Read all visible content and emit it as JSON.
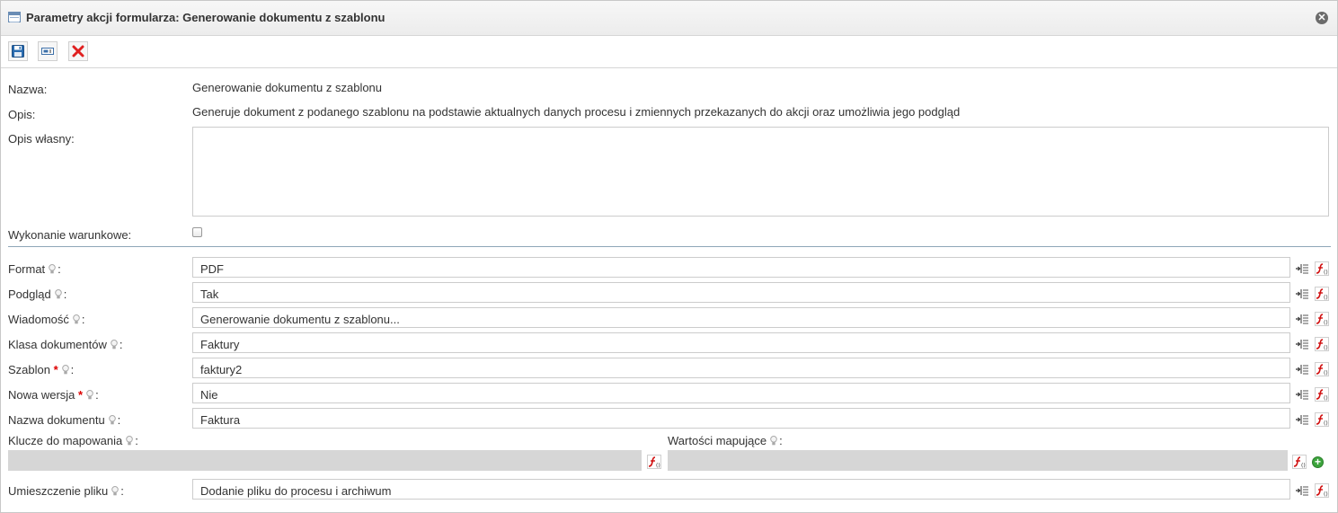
{
  "window": {
    "title": "Parametry akcji formularza: Generowanie dokumentu z szablonu"
  },
  "info": {
    "name_label": "Nazwa:",
    "name_value": "Generowanie dokumentu z szablonu",
    "desc_label": "Opis:",
    "desc_value": "Generuje dokument z podanego szablonu na podstawie aktualnych danych procesu i zmiennych przekazanych do akcji oraz umożliwia jego podgląd",
    "custom_desc_label": "Opis własny:",
    "custom_desc_value": "",
    "conditional_label": "Wykonanie warunkowe:",
    "conditional_checked": false
  },
  "params": [
    {
      "label": "Format",
      "required": false,
      "value": "PDF"
    },
    {
      "label": "Podgląd",
      "required": false,
      "value": "Tak"
    },
    {
      "label": "Wiadomość",
      "required": false,
      "value": "Generowanie dokumentu z szablonu..."
    },
    {
      "label": "Klasa dokumentów",
      "required": false,
      "value": "Faktury"
    },
    {
      "label": "Szablon",
      "required": true,
      "value": "faktury2"
    },
    {
      "label": "Nowa wersja",
      "required": true,
      "value": "Nie"
    },
    {
      "label": "Nazwa dokumentu",
      "required": false,
      "value": "Faktura"
    }
  ],
  "mapping": {
    "keys_label": "Klucze do mapowania",
    "keys_value": "",
    "values_label": "Wartości mapujące",
    "values_value": ""
  },
  "placement": {
    "label": "Umieszczenie pliku",
    "value": "Dodanie pliku do procesu i archiwum"
  },
  "colors": {
    "required_star": "#dd0000",
    "divider": "#8fa6b8",
    "save_icon": "#2a6cb0",
    "delete_icon": "#e02020",
    "add_icon": "#3ca43c"
  },
  "icons": [
    "table-icon",
    "close-icon",
    "save-icon",
    "text-field-icon",
    "delete-icon",
    "lightbulb-icon",
    "insert-variable-icon",
    "formula-icon",
    "add-icon"
  ]
}
